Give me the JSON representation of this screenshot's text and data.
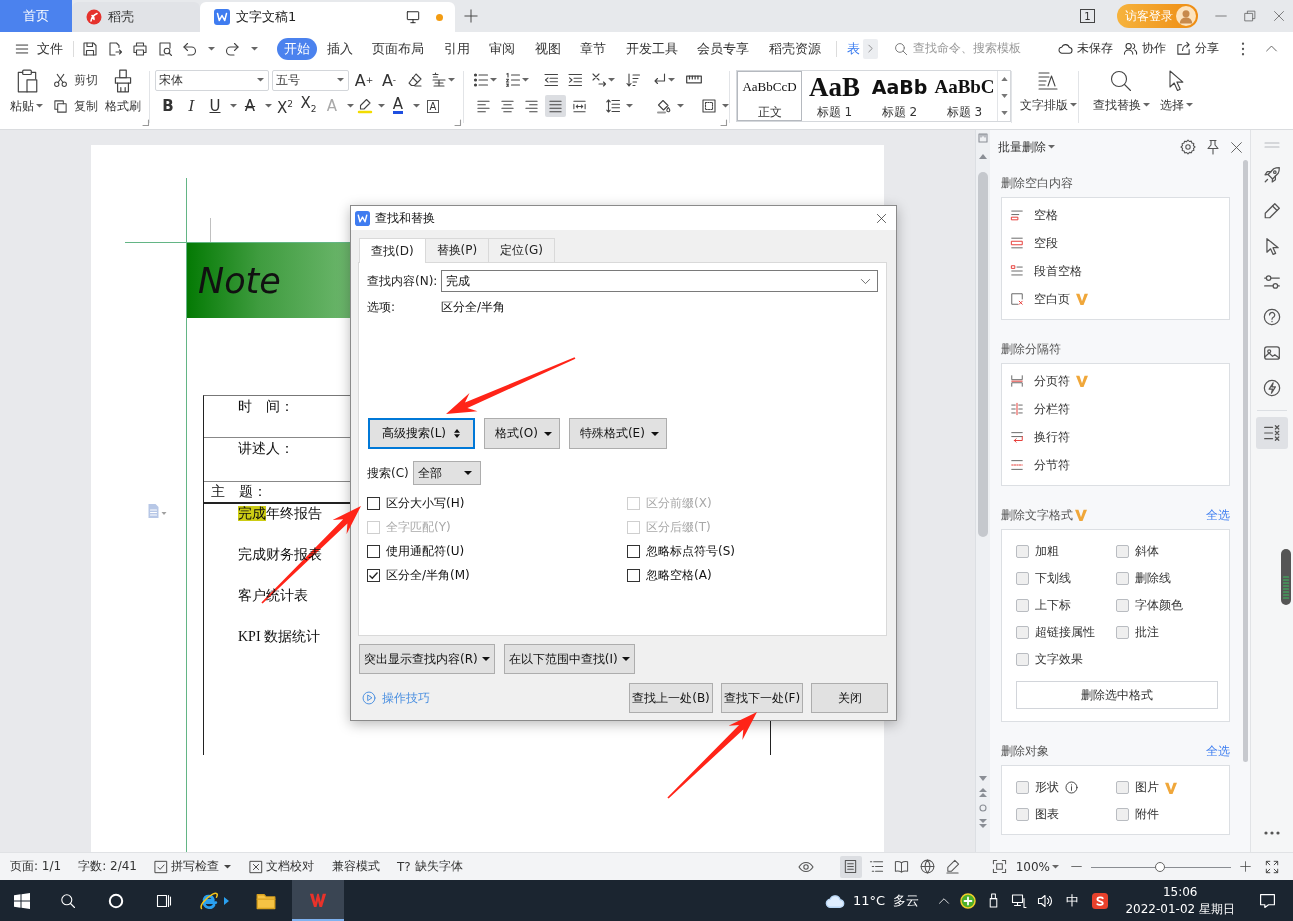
{
  "title_bar": {
    "tabs": [
      {
        "kind": "home",
        "label": "首页",
        "selected": false,
        "unsaved": false
      },
      {
        "kind": "docer",
        "label": "稻壳",
        "selected": false,
        "unsaved": false
      },
      {
        "kind": "writer",
        "label": "文字文稿1",
        "selected": true,
        "unsaved": true
      }
    ],
    "window_count": "1",
    "login": "访客登录"
  },
  "menu_bar": {
    "file": "文件",
    "tabs": [
      {
        "kind": "tab",
        "label": "开始",
        "selected": true
      },
      {
        "kind": "tab",
        "label": "插入",
        "selected": false
      },
      {
        "kind": "tab",
        "label": "页面布局",
        "selected": false
      },
      {
        "kind": "tab",
        "label": "引用",
        "selected": false
      },
      {
        "kind": "tab",
        "label": "审阅",
        "selected": false
      },
      {
        "kind": "tab",
        "label": "视图",
        "selected": false
      },
      {
        "kind": "tab",
        "label": "章节",
        "selected": false
      },
      {
        "kind": "tab",
        "label": "开发工具",
        "selected": false
      },
      {
        "kind": "tab",
        "label": "会员专享",
        "selected": false
      },
      {
        "kind": "tab",
        "label": "稻壳资源",
        "selected": false
      },
      {
        "kind": "contextual",
        "label": "表",
        "selected": false
      }
    ],
    "search": {
      "placeholder": "查找命令、搜索模板"
    },
    "actions": [
      {
        "kind": "cloud",
        "label": "未保存"
      },
      {
        "kind": "people",
        "label": "协作"
      },
      {
        "kind": "share",
        "label": "分享"
      }
    ]
  },
  "ribbon": {
    "clipboard": {
      "paste": "粘贴",
      "cut": "剪切",
      "copy": "复制",
      "format_painter": "格式刷"
    },
    "font": {
      "name": "宋体",
      "size": "五号",
      "grow": "A$^{+}$",
      "shrink": "A$^{-}$",
      "buttons": [
        {
          "kind": "bold",
          "glyph": "B",
          "dropdown": false
        },
        {
          "kind": "italic",
          "glyph": "I",
          "dropdown": false
        },
        {
          "kind": "underline",
          "glyph": "U",
          "dropdown": true
        },
        {
          "kind": "strike",
          "glyph": "A",
          "dropdown": true
        },
        {
          "kind": "superscript",
          "glyph": "X$^{2}$",
          "dropdown": false
        },
        {
          "kind": "subscript",
          "glyph": "X$_{2}$",
          "dropdown": false
        },
        {
          "kind": "effect",
          "glyph": "A",
          "dropdown": true
        },
        {
          "kind": "highlight",
          "dropdown": true
        },
        {
          "kind": "color",
          "glyph": "A",
          "dropdown": true
        },
        {
          "kind": "border",
          "glyph": "A",
          "dropdown": false
        }
      ]
    },
    "paragraph": {
      "align": [
        {
          "kind": "left",
          "selected": false
        },
        {
          "kind": "center",
          "selected": false
        },
        {
          "kind": "right",
          "selected": false
        },
        {
          "kind": "justify",
          "selected": true
        },
        {
          "kind": "distributed",
          "selected": false
        }
      ]
    },
    "styles": [
      {
        "kind": "body",
        "preview": "AaBbCcD",
        "label": "正文",
        "selected": true
      },
      {
        "kind": "h1",
        "preview": "AaB",
        "label": "标题 1",
        "selected": false
      },
      {
        "kind": "h2",
        "preview": "AaBb",
        "label": "标题 2",
        "selected": false
      },
      {
        "kind": "h3",
        "preview": "AaBbC",
        "label": "标题 3",
        "selected": false
      }
    ],
    "tools": [
      {
        "kind": "layout",
        "label": "文字排版"
      },
      {
        "kind": "find",
        "label": "查找替换"
      },
      {
        "kind": "select",
        "label": "选择"
      }
    ]
  },
  "document": {
    "banner": "Note",
    "fields": [
      "时　间：",
      "讲述人："
    ],
    "subject_label": "主　题：",
    "items": [
      {
        "segments": [
          {
            "text": "完成",
            "highlighted": true
          },
          {
            "text": "年终报告",
            "highlighted": false
          }
        ]
      },
      {
        "segments": [
          {
            "text": "完成财务报表",
            "highlighted": false
          }
        ]
      },
      {
        "segments": [
          {
            "text": "客户统计表",
            "highlighted": false
          }
        ]
      },
      {
        "segments": [
          {
            "text": "KPI 数据统计",
            "highlighted": false
          }
        ]
      }
    ]
  },
  "dialog": {
    "title": "查找和替换",
    "tabs": [
      {
        "label": "查找(D)",
        "selected": true
      },
      {
        "label": "替换(P)",
        "selected": false
      },
      {
        "label": "定位(G)",
        "selected": false
      }
    ],
    "find": {
      "label": "查找内容(N):",
      "value": "完成"
    },
    "options": {
      "label": "选项:",
      "value": "区分全/半角"
    },
    "option_buttons": [
      {
        "kind": "toggle",
        "label": "高级搜索(L)",
        "focused": true
      },
      {
        "kind": "menu",
        "label": "格式(O)",
        "focused": false
      },
      {
        "kind": "menu",
        "label": "特殊格式(E)",
        "focused": false
      }
    ],
    "scope": {
      "label": "搜索(C)",
      "value": "全部"
    },
    "checkboxes": [
      {
        "label": "区分大小写(H)",
        "checked": false,
        "disabled": false
      },
      {
        "label": "区分前缀(X)",
        "checked": false,
        "disabled": true
      },
      {
        "label": "全字匹配(Y)",
        "checked": false,
        "disabled": true
      },
      {
        "label": "区分后缀(T)",
        "checked": false,
        "disabled": true
      },
      {
        "label": "使用通配符(U)",
        "checked": false,
        "disabled": false
      },
      {
        "label": "忽略标点符号(S)",
        "checked": false,
        "disabled": false
      },
      {
        "label": "区分全/半角(M)",
        "checked": true,
        "disabled": false
      },
      {
        "label": "忽略空格(A)",
        "checked": false,
        "disabled": false
      }
    ],
    "menus": [
      "突出显示查找内容(R)",
      "在以下范围中查找(I)"
    ],
    "tips": "操作技巧",
    "buttons": [
      "查找上一处(B)",
      "查找下一处(F)",
      "关闭"
    ]
  },
  "side_panel": {
    "title": "批量删除",
    "sections": [
      {
        "kind": "actions",
        "title": "删除空白内容",
        "vip": false,
        "items": [
          {
            "label": "空格",
            "vip": false
          },
          {
            "label": "空段",
            "vip": false
          },
          {
            "label": "段首空格",
            "vip": false
          },
          {
            "label": "空白页",
            "vip": true
          }
        ]
      },
      {
        "kind": "actions",
        "title": "删除分隔符",
        "vip": false,
        "items": [
          {
            "label": "分页符",
            "vip": true
          },
          {
            "label": "分栏符",
            "vip": false
          },
          {
            "label": "换行符",
            "vip": false
          },
          {
            "label": "分节符",
            "vip": false
          }
        ]
      },
      {
        "kind": "checklist",
        "title": "删除文字格式",
        "vip": true,
        "select_all": "全选",
        "items": [
          {
            "label": "加粗",
            "checked": false
          },
          {
            "label": "斜体",
            "checked": false
          },
          {
            "label": "下划线",
            "checked": false
          },
          {
            "label": "删除线",
            "checked": false
          },
          {
            "label": "上下标",
            "checked": false
          },
          {
            "label": "字体颜色",
            "checked": false
          },
          {
            "label": "超链接属性",
            "checked": false
          },
          {
            "label": "批注",
            "checked": false
          },
          {
            "label": "文字效果",
            "checked": false
          }
        ],
        "button": "删除选中格式"
      },
      {
        "kind": "checklist",
        "title": "删除对象",
        "vip": false,
        "select_all": "全选",
        "items": [
          {
            "label": "形状",
            "checked": false,
            "info": true,
            "vip": false
          },
          {
            "label": "图片",
            "checked": false,
            "info": false,
            "vip": true
          },
          {
            "label": "图表",
            "checked": false,
            "info": false,
            "vip": false
          },
          {
            "label": "附件",
            "checked": false,
            "info": false,
            "vip": false
          }
        ]
      }
    ]
  },
  "side_tools": [
    {
      "selected": false
    },
    {
      "selected": false
    },
    {
      "selected": false
    },
    {
      "selected": false
    },
    {
      "selected": false
    },
    {
      "selected": false
    },
    {
      "selected": false
    },
    {
      "selected": true
    }
  ],
  "status_bar": {
    "items": [
      {
        "kind": "text",
        "label": "页面: 1/1"
      },
      {
        "kind": "text",
        "label": "字数: 2/41"
      },
      {
        "kind": "spellcheck",
        "label": "拼写检查"
      },
      {
        "kind": "proofread",
        "label": "文档校对"
      },
      {
        "kind": "text",
        "label": "兼容模式"
      },
      {
        "kind": "fonts",
        "glyph": "T?",
        "label": "缺失字体"
      }
    ],
    "views": [
      {
        "selected": true
      },
      {
        "selected": false
      },
      {
        "selected": false
      },
      {
        "selected": false
      },
      {
        "selected": false
      }
    ],
    "zoom": "100%",
    "zoom_slider": {
      "level": 0.49
    }
  },
  "taskbar": {
    "apps": [
      {
        "kind": "browser",
        "active": false
      },
      {
        "kind": "folder",
        "active": false
      },
      {
        "kind": "writer",
        "active": true
      }
    ],
    "weather": "11°C  多云",
    "ime": "中",
    "time": "15:06",
    "date": "2022-01-02 星期日"
  }
}
